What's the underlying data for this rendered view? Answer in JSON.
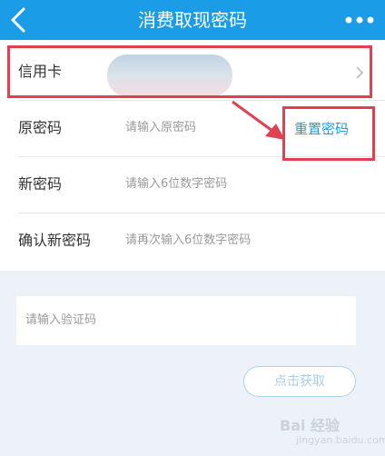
{
  "header": {
    "title": "消费取现密码",
    "back_icon": "back-chevron-icon",
    "more_icon": "more-dots-icon",
    "bg_color": "#1a9de6"
  },
  "form": {
    "card_label": "信用卡",
    "old_label": "原密码",
    "old_placeholder": "请输入原密码",
    "reset_label": "重置密码",
    "new_label": "新密码",
    "new_placeholder": "请输入6位数字密码",
    "confirm_label": "确认新密码",
    "confirm_placeholder": "请再次输入6位数字密码"
  },
  "verify": {
    "placeholder": "请输入验证码",
    "get_code_label": "点击获取"
  },
  "watermark": {
    "text": "Bai 经验",
    "sub": "jingyan.baidu.com"
  },
  "colors": {
    "accent": "#1a9de6",
    "annotation_red": "#e04050"
  }
}
